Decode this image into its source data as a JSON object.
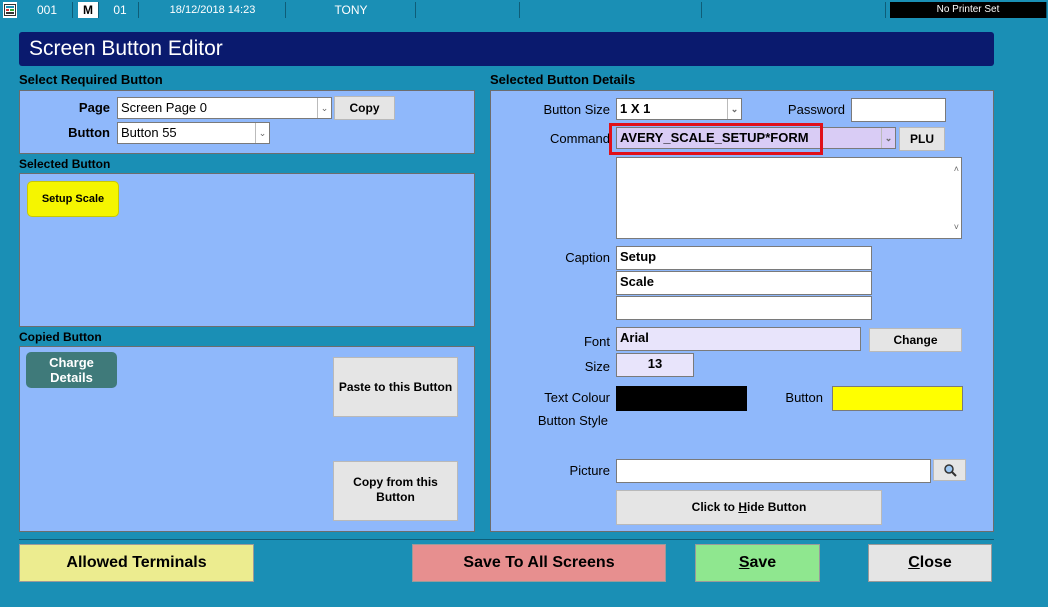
{
  "status_bar": {
    "terminal": "001",
    "mode": "M",
    "clerk": "01",
    "datetime": "18/12/2018 14:23",
    "user": "TONY",
    "printer": "No Printer Set"
  },
  "title": "Screen Button Editor",
  "select_required": {
    "heading": "Select Required Button",
    "page_label": "Page",
    "page_value": "Screen Page 0",
    "copy_label": "Copy",
    "button_label": "Button",
    "button_value": "Button 55"
  },
  "selected_button": {
    "heading": "Selected Button",
    "preview_label": "Setup Scale",
    "preview_color": "#f5f500"
  },
  "copied_button": {
    "heading": "Copied Button",
    "preview_line1": "Charge",
    "preview_line2": "Details",
    "preview_color": "#3f7a7a",
    "paste_label": "Paste to this Button",
    "copy_line1": "Copy from this",
    "copy_line2": "Button"
  },
  "details": {
    "heading": "Selected Button Details",
    "size_label": "Button Size",
    "size_value": "1 X 1",
    "password_label": "Password",
    "password_value": "",
    "command_label": "Command",
    "command_value": "AVERY_SCALE_SETUP*FORM",
    "plu_label": "PLU",
    "command_text": "",
    "caption_label": "Caption",
    "caption_lines": [
      "Setup",
      "Scale",
      ""
    ],
    "font_label": "Font",
    "font_value": "Arial",
    "change_label": "Change",
    "fontsize_label": "Size",
    "fontsize_value": "13",
    "text_colour_label": "Text Colour",
    "text_colour": "#000000",
    "button_colour_label": "Button",
    "button_colour": "#ffff00",
    "button_style_label": "Button Style",
    "picture_label": "Picture",
    "picture_value": "",
    "picture_browse_icon": "magnifier-icon",
    "hide_prefix": "Click to ",
    "hide_underline": "H",
    "hide_suffix": "ide Button"
  },
  "footer": {
    "allowed_label": "Allowed Terminals",
    "allowed_color": "#ecec8f",
    "save_all_label": "Save To All Screens",
    "save_all_color": "#e78f8f",
    "save_underline": "S",
    "save_rest": "ave",
    "save_color": "#8fe78f",
    "close_underline": "C",
    "close_rest": "lose",
    "close_color": "#e5e5e5"
  },
  "colors": {
    "background": "#1a8fb5",
    "panel": "#8fb8fb",
    "title": "#0a1a6e",
    "highlight": "#e0101a"
  }
}
